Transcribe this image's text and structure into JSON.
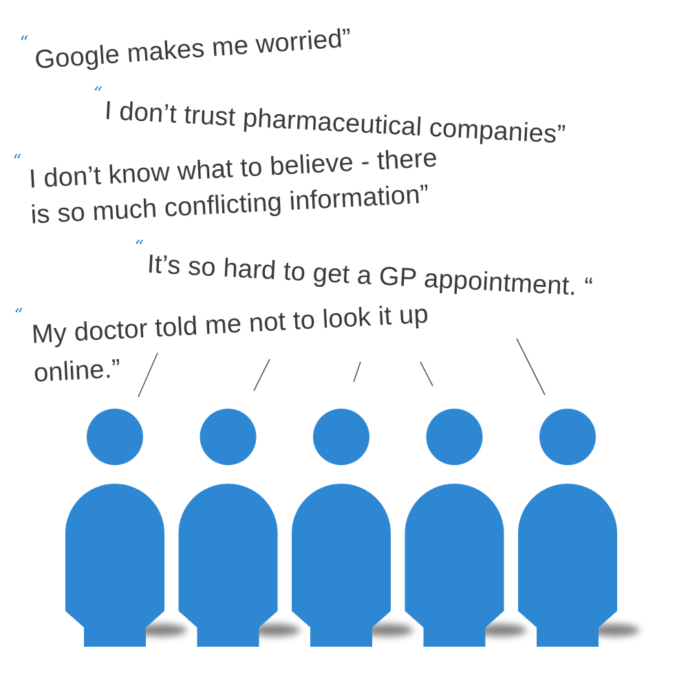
{
  "quotes": [
    {
      "open": "“",
      "lines": [
        "Google makes me worried”"
      ]
    },
    {
      "open": "“",
      "lines": [
        "I don’t trust pharmaceutical companies”"
      ]
    },
    {
      "open": "“",
      "lines": [
        "I don’t know what to believe - there",
        "is so much conflicting information”"
      ]
    },
    {
      "open": "“",
      "lines": [
        "It’s so hard to get a GP appointment. “"
      ]
    },
    {
      "open": "“",
      "lines": [
        "My doctor told me not to look it up",
        "online.”"
      ]
    }
  ],
  "people_count": 5,
  "colors": {
    "person": "#2e87d3",
    "quote_mark": "#2e7fd0",
    "text": "#3a3a3a",
    "pointer_line": "#444444",
    "shadow": "#5a5a5a"
  },
  "icons": [
    "person-icon"
  ]
}
